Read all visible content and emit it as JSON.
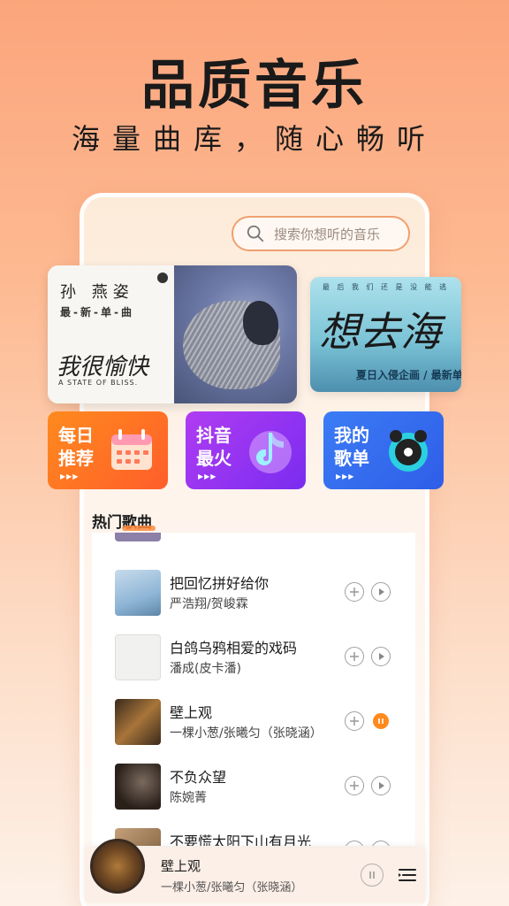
{
  "hero": {
    "title": "品质音乐",
    "subtitle": "海量曲库，随心畅听"
  },
  "search": {
    "placeholder": "搜索你想听的音乐",
    "icon": "search-icon"
  },
  "banners": {
    "main": {
      "artist": "孙 燕姿",
      "tag": "最-新-单-曲",
      "song": "我很愉快",
      "subtitle": "A STATE OF BLISS."
    },
    "side": {
      "top_line": "最 后 我 们 还 是 没 能 逃",
      "title": "想去海",
      "bottom": "夏日入侵企画 / 最新单"
    }
  },
  "quick_entries": [
    {
      "label": "每日推荐",
      "line1": "每日",
      "line2": "推荐",
      "icon": "calendar-icon",
      "dots": "▶▶▶"
    },
    {
      "label": "抖音最火",
      "line1": "抖音",
      "line2": "最火",
      "icon": "tiktok-note-icon",
      "dots": "▶▶▶"
    },
    {
      "label": "我的歌单",
      "line1": "我的",
      "line2": "歌单",
      "icon": "vinyl-record-icon",
      "dots": "▶▶▶"
    }
  ],
  "hot_songs": {
    "title": "热门歌曲",
    "items": [
      {
        "title": "把回忆拼好给你",
        "artist": "严浩翔/贺峻霖",
        "state": "idle",
        "cover_color": "#8fb6d6"
      },
      {
        "title": "白鸽乌鸦相爱的戏码",
        "artist": "潘成(皮卡潘)",
        "state": "idle",
        "cover_color": "#eeeeee"
      },
      {
        "title": "壁上观",
        "artist": "一棵小葱/张曦匀（张晓涵）",
        "state": "playing",
        "cover_color": "#8a5a2a"
      },
      {
        "title": "不负众望",
        "artist": "陈婉菁",
        "state": "idle",
        "cover_color": "#3a2e28"
      },
      {
        "title": "不要慌太阳下山有月光",
        "artist": "",
        "state": "idle",
        "cover_color": "#9a7a5a"
      }
    ]
  },
  "player": {
    "title": "壁上观",
    "artist": "一棵小葱/张曦匀（张晓涵）"
  },
  "colors": {
    "accent": "#ff8a1e",
    "background_top": "#fca57c",
    "daily_card": "#ff6a26",
    "douyin_card": "#9a34f2",
    "playlist_card": "#356cf0"
  }
}
